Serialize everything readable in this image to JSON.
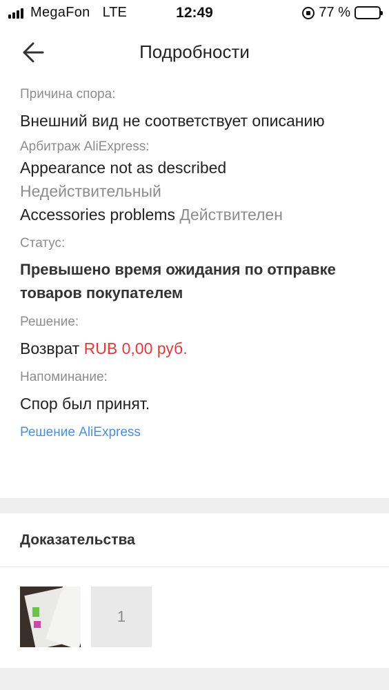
{
  "status_bar": {
    "carrier": "MegaFon",
    "network": "LTE",
    "time": "12:49",
    "battery": "77 %",
    "battery_level": 0.77
  },
  "nav": {
    "title": "Подробности",
    "back_icon": "arrow-left-icon"
  },
  "dispute": {
    "reason_label": "Причина спора:",
    "reason_value": "Внешний вид не соответствует описанию",
    "arbitration_label": "Арбитраж AliExpress:",
    "arbitration_items": [
      {
        "name": "Appearance not as described",
        "state": "Недействительный"
      },
      {
        "name": "Accessories problems",
        "state": "Действителен"
      }
    ],
    "status_label": "Статус:",
    "status_value": "Превышено время ожидания по отправке товаров покупателем",
    "decision_label": "Решение:",
    "decision_prefix": "Возврат",
    "decision_amount": "RUB 0,00 руб.",
    "reminder_label": "Напоминание:",
    "reminder_value": "Спор был принят.",
    "decision_link": "Решение AliExpress"
  },
  "evidence": {
    "title": "Доказательства",
    "more_count": "1"
  },
  "colors": {
    "accent_red": "#e4393c",
    "link_blue": "#4a90d9",
    "muted_gray": "#8c8c8c",
    "band_gray": "#efefef"
  }
}
